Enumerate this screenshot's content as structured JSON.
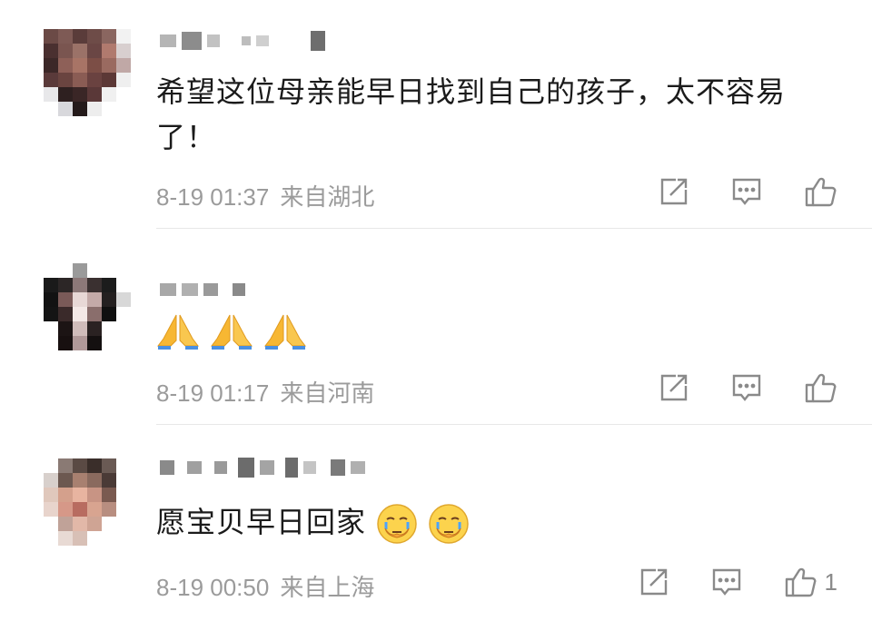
{
  "comments": [
    {
      "text": "希望这位母亲能早日找到自己的孩子，太不容易了！",
      "date": "8-19 01:37",
      "location": "来自湖北",
      "like_count": ""
    },
    {
      "text": "",
      "emojis": [
        "folded-hands",
        "folded-hands",
        "folded-hands"
      ],
      "date": "8-19 01:17",
      "location": "来自河南",
      "like_count": ""
    },
    {
      "text": "愿宝贝早日回家",
      "emojis": [
        "crying-face",
        "crying-face"
      ],
      "date": "8-19 00:50",
      "location": "来自上海",
      "like_count": "1"
    }
  ],
  "colors": {
    "text": "#1b1b1b",
    "meta": "#9b9b9b",
    "icon": "#8a8a8a",
    "divider": "#e8e8e8"
  },
  "icons": [
    "share-icon",
    "comment-icon",
    "like-icon"
  ]
}
